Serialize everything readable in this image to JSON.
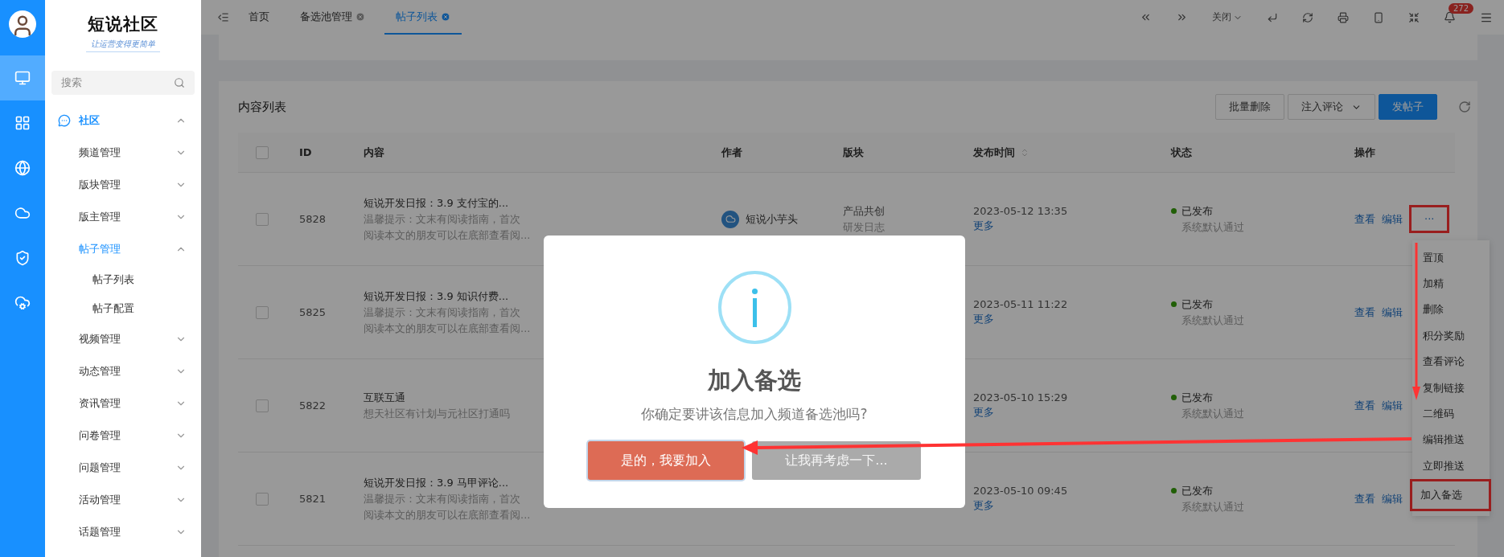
{
  "rail": {
    "items": [
      {
        "selected": true
      },
      {
        "selected": false
      },
      {
        "selected": false
      },
      {
        "selected": false
      },
      {
        "selected": false
      },
      {
        "selected": false
      }
    ]
  },
  "brand": {
    "title": "短说社区",
    "slogan": "让运营变得更简单"
  },
  "search": {
    "placeholder": "搜索"
  },
  "nav": [
    {
      "label": "社区",
      "expanded": true,
      "children": [
        {
          "label": "频道管理",
          "expanded": false,
          "selected": false
        },
        {
          "label": "版块管理",
          "expanded": false,
          "selected": false
        },
        {
          "label": "版主管理",
          "expanded": false,
          "selected": false
        },
        {
          "label": "帖子管理",
          "expanded": true,
          "selected": true,
          "children": [
            {
              "label": "帖子列表"
            },
            {
              "label": "帖子配置"
            }
          ]
        },
        {
          "label": "视频管理",
          "expanded": false,
          "selected": false
        },
        {
          "label": "动态管理",
          "expanded": false,
          "selected": false
        },
        {
          "label": "资讯管理",
          "expanded": false,
          "selected": false
        },
        {
          "label": "问卷管理",
          "expanded": false,
          "selected": false
        },
        {
          "label": "问题管理",
          "expanded": false,
          "selected": false
        },
        {
          "label": "活动管理",
          "expanded": false,
          "selected": false
        },
        {
          "label": "话题管理",
          "expanded": false,
          "selected": false
        }
      ]
    }
  ],
  "tabs": [
    {
      "label": "首页",
      "selected": false,
      "closable": false
    },
    {
      "label": "备选池管理",
      "selected": false,
      "closable": true
    },
    {
      "label": "帖子列表",
      "selected": true,
      "closable": true
    }
  ],
  "toolbar": {
    "close_menu": "关闭",
    "badge": "272"
  },
  "card": {
    "title": "内容列表",
    "buttons": [
      {
        "label": "批量删除",
        "kind": "default"
      },
      {
        "label": "注入评论",
        "kind": "dropdown"
      },
      {
        "label": "发帖子",
        "kind": "primary"
      }
    ]
  },
  "table": {
    "header_checked": false,
    "columns": [
      {
        "label": "ID",
        "sortable": false
      },
      {
        "label": "内容",
        "sortable": false
      },
      {
        "label": "作者",
        "sortable": false
      },
      {
        "label": "版块",
        "sortable": false
      },
      {
        "label": "发布时间",
        "sortable": true
      },
      {
        "label": "状态",
        "sortable": false
      },
      {
        "label": "操作",
        "sortable": false
      }
    ],
    "rows": [
      {
        "checked": false,
        "id": "5828",
        "title": "短说开发日报：3.9 支付宝的...",
        "summary_lines": [
          "温馨提示：文末有阅读指南，首次",
          "阅读本文的朋友可以在底部查看阅..."
        ],
        "author": "短说小芋头",
        "board": "产品共创",
        "sub_board": "研发日志",
        "time": "2023-05-12 13:35",
        "more": "更多",
        "status": "已发布",
        "status_note": "系统默认通过",
        "actions": [
          {
            "label": "查看",
            "framed": false
          },
          {
            "label": "编辑",
            "framed": false
          },
          {
            "label": "···",
            "framed": true
          }
        ]
      },
      {
        "checked": false,
        "id": "5825",
        "title": "短说开发日报：3.9 知识付费...",
        "summary_lines": [
          "温馨提示：文末有阅读指南，首次",
          "阅读本文的朋友可以在底部查看阅..."
        ],
        "time": "2023-05-11 11:22",
        "more": "更多",
        "status": "已发布",
        "status_note": "系统默认通过",
        "actions": [
          {
            "label": "查看",
            "framed": false
          },
          {
            "label": "编辑",
            "framed": false
          }
        ]
      },
      {
        "checked": false,
        "id": "5822",
        "title": "互联互通",
        "summary_lines": [
          "想天社区有计划与元社区打通吗"
        ],
        "time": "2023-05-10 15:29",
        "more": "更多",
        "status": "已发布",
        "status_note": "系统默认通过",
        "actions": [
          {
            "label": "查看",
            "framed": false
          },
          {
            "label": "编辑",
            "framed": false
          }
        ]
      },
      {
        "checked": false,
        "id": "5821",
        "title": "短说开发日报：3.9 马甲评论...",
        "summary_lines": [
          "温馨提示：文末有阅读指南，首次",
          "阅读本文的朋友可以在底部查看阅..."
        ],
        "time": "2023-05-10 09:45",
        "more": "更多",
        "status": "已发布",
        "status_note": "系统默认通过",
        "actions": [
          {
            "label": "查看",
            "framed": false
          },
          {
            "label": "编辑",
            "framed": false
          }
        ]
      }
    ]
  },
  "menu": {
    "items": [
      {
        "label": "置顶",
        "framed": false
      },
      {
        "label": "加精",
        "framed": false
      },
      {
        "label": "删除",
        "framed": false
      },
      {
        "label": "积分奖励",
        "framed": false
      },
      {
        "label": "查看评论",
        "framed": false
      },
      {
        "label": "复制链接",
        "framed": false
      },
      {
        "label": "二维码",
        "framed": false
      },
      {
        "label": "编辑推送",
        "framed": false
      },
      {
        "label": "立即推送",
        "framed": false
      },
      {
        "label": "加入备选",
        "framed": true
      }
    ]
  },
  "dialog": {
    "title": "加入备选",
    "message": "你确定要讲该信息加入频道备选池吗?",
    "confirm": "是的，我要加入",
    "cancel": "让我再考虑一下..."
  }
}
